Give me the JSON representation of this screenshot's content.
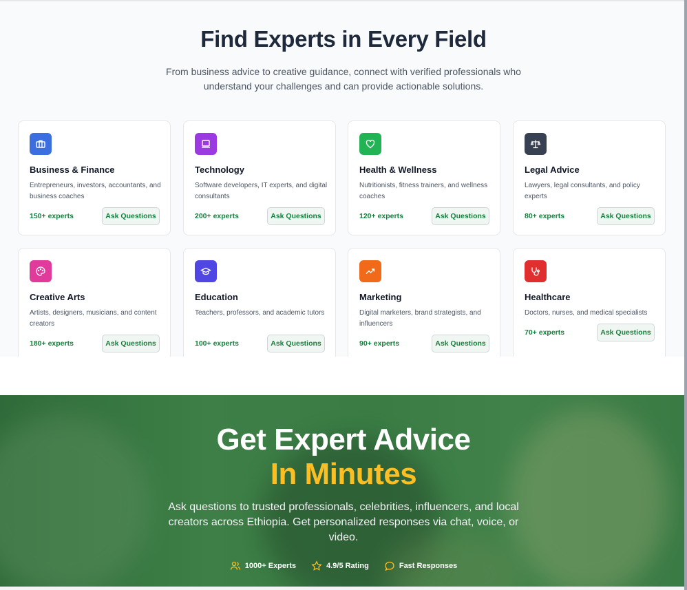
{
  "fields_section": {
    "title": "Find Experts in Every Field",
    "subtitle": "From business advice to creative guidance, connect with verified professionals who understand your challenges and can provide actionable solutions.",
    "categories": [
      {
        "title": "Business & Finance",
        "description": "Entrepreneurs, investors, accountants, and business coaches",
        "count": "150+ experts",
        "button": "Ask Questions",
        "icon": "briefcase-icon",
        "color": "#3b6fe0"
      },
      {
        "title": "Technology",
        "description": "Software developers, IT experts, and digital consultants",
        "count": "200+ experts",
        "button": "Ask Questions",
        "icon": "laptop-icon",
        "color": "#9b3ae0"
      },
      {
        "title": "Health & Wellness",
        "description": "Nutritionists, fitness trainers, and wellness coaches",
        "count": "120+ experts",
        "button": "Ask Questions",
        "icon": "heart-icon",
        "color": "#22b454"
      },
      {
        "title": "Legal Advice",
        "description": "Lawyers, legal consultants, and policy experts",
        "count": "80+ experts",
        "button": "Ask Questions",
        "icon": "scale-icon",
        "color": "#374151"
      },
      {
        "title": "Creative Arts",
        "description": "Artists, designers, musicians, and content creators",
        "count": "180+ experts",
        "button": "Ask Questions",
        "icon": "palette-icon",
        "color": "#e03a9a"
      },
      {
        "title": "Education",
        "description": "Teachers, professors, and academic tutors",
        "count": "100+ experts",
        "button": "Ask Questions",
        "icon": "graduation-cap-icon",
        "color": "#5046e4"
      },
      {
        "title": "Marketing",
        "description": "Digital marketers, brand strategists, and influencers",
        "count": "90+ experts",
        "button": "Ask Questions",
        "icon": "trending-up-icon",
        "color": "#f06a1a"
      },
      {
        "title": "Healthcare",
        "description": "Doctors, nurses, and medical specialists",
        "count": "70+ experts",
        "button": "Ask Questions",
        "icon": "stethoscope-icon",
        "color": "#e02f2f"
      }
    ]
  },
  "hero": {
    "title_line1": "Get Expert Advice",
    "title_line2": "In Minutes",
    "paragraph": "Ask questions to trusted professionals, celebrities, influencers, and local creators across Ethiopia. Get personalized responses via chat, voice, or video.",
    "accent_color": "#fbbf24",
    "stats": [
      {
        "icon": "users-icon",
        "label": "1000+ Experts"
      },
      {
        "icon": "star-icon",
        "label": "4.9/5 Rating"
      },
      {
        "icon": "chat-bubble-icon",
        "label": "Fast Responses"
      }
    ]
  }
}
